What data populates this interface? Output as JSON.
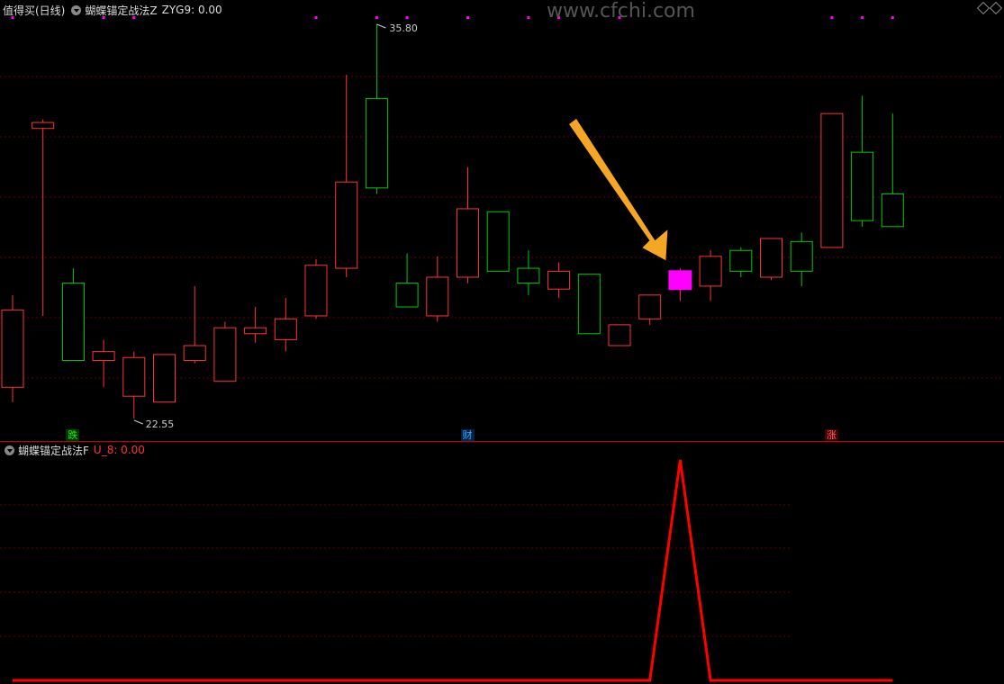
{
  "main_panel": {
    "title": "值得买(日线)",
    "indicator_name": "蝴蝶锚定战法Z",
    "indicator_value": "ZYG9: 0.00",
    "high_label": "35.80",
    "low_label": "22.55",
    "signals": [
      {
        "text": "跌",
        "color": "#00ff00",
        "bg": "#003300"
      },
      {
        "text": "财",
        "color": "#33aaff",
        "bg": "#002244"
      },
      {
        "text": "涨",
        "color": "#ff6666",
        "bg": "#440000"
      }
    ]
  },
  "sub_panel": {
    "indicator_name": "蝴蝶锚定战法F",
    "indicator_value": "U_8: 0.00"
  },
  "watermark": "www.cfchi.com",
  "colors": {
    "up": "#ff3333",
    "down": "#00cc00",
    "highlight": "#ff00ff",
    "line": "#ff0000",
    "grid": "#660000",
    "arrow": "#f5a623"
  },
  "chart_data": [
    {
      "type": "candlestick",
      "price_range": [
        22.55,
        35.8
      ],
      "candles": [
        {
          "o": 23.6,
          "c": 26.2,
          "h": 26.7,
          "l": 23.1
        },
        {
          "o": 32.3,
          "c": 32.5,
          "h": 32.6,
          "l": 26.0
        },
        {
          "o": 27.1,
          "c": 24.5,
          "h": 27.6,
          "l": 24.5
        },
        {
          "o": 24.5,
          "c": 24.8,
          "h": 25.2,
          "l": 23.6
        },
        {
          "o": 23.3,
          "c": 24.6,
          "h": 24.8,
          "l": 22.55
        },
        {
          "o": 23.1,
          "c": 24.7,
          "h": 24.7,
          "l": 23.1
        },
        {
          "o": 24.5,
          "c": 25.0,
          "h": 27.0,
          "l": 24.4
        },
        {
          "o": 23.8,
          "c": 25.6,
          "h": 25.8,
          "l": 23.8
        },
        {
          "o": 25.4,
          "c": 25.6,
          "h": 26.3,
          "l": 25.1
        },
        {
          "o": 25.2,
          "c": 25.9,
          "h": 26.6,
          "l": 24.8
        },
        {
          "o": 26.0,
          "c": 27.7,
          "h": 27.9,
          "l": 25.9
        },
        {
          "o": 27.6,
          "c": 30.5,
          "h": 34.1,
          "l": 27.3
        },
        {
          "o": 33.3,
          "c": 30.3,
          "h": 35.8,
          "l": 30.1
        },
        {
          "o": 27.1,
          "c": 26.3,
          "h": 28.1,
          "l": 26.3
        },
        {
          "o": 26.0,
          "c": 27.3,
          "h": 28.0,
          "l": 25.8
        },
        {
          "o": 27.3,
          "c": 29.6,
          "h": 31.0,
          "l": 27.1
        },
        {
          "o": 29.5,
          "c": 27.5,
          "h": 29.5,
          "l": 27.5
        },
        {
          "o": 27.6,
          "c": 27.1,
          "h": 28.2,
          "l": 26.7
        },
        {
          "o": 26.9,
          "c": 27.5,
          "h": 27.8,
          "l": 26.6
        },
        {
          "o": 27.4,
          "c": 25.4,
          "h": 27.4,
          "l": 25.4
        },
        {
          "o": 25.0,
          "c": 25.7,
          "h": 25.7,
          "l": 25.0
        },
        {
          "o": 25.9,
          "c": 26.7,
          "h": 26.7,
          "l": 25.7
        },
        {
          "o": 26.6,
          "c": 27.2,
          "h": 27.6,
          "l": 26.5
        },
        {
          "o": 27.0,
          "c": 28.0,
          "h": 28.2,
          "l": 26.5
        },
        {
          "o": 28.2,
          "c": 27.5,
          "h": 28.3,
          "l": 27.3
        },
        {
          "o": 27.3,
          "c": 28.6,
          "h": 28.6,
          "l": 27.2
        },
        {
          "o": 28.5,
          "c": 27.5,
          "h": 28.8,
          "l": 27.0
        },
        {
          "o": 28.3,
          "c": 32.8,
          "h": 32.8,
          "l": 28.3
        },
        {
          "o": 31.5,
          "c": 29.2,
          "h": 33.4,
          "l": 29.0
        },
        {
          "o": 30.1,
          "c": 29.0,
          "h": 32.8,
          "l": 29.0
        }
      ],
      "highlight_index": 22,
      "signal_indices": [
        2,
        15,
        27
      ]
    },
    {
      "type": "line",
      "name": "U_8",
      "x": [
        0,
        1,
        2,
        3,
        4,
        5,
        6,
        7,
        8,
        9,
        10,
        11,
        12,
        13,
        14,
        15,
        16,
        17,
        18,
        19,
        20,
        21,
        22,
        23,
        24,
        25,
        26,
        27,
        28,
        29
      ],
      "y": [
        0,
        0,
        0,
        0,
        0,
        0,
        0,
        0,
        0,
        0,
        0,
        0,
        0,
        0,
        0,
        0,
        0,
        0,
        0,
        0,
        0,
        0,
        1,
        0,
        0,
        0,
        0,
        0,
        0,
        0
      ],
      "ylim": [
        0,
        1
      ]
    }
  ]
}
